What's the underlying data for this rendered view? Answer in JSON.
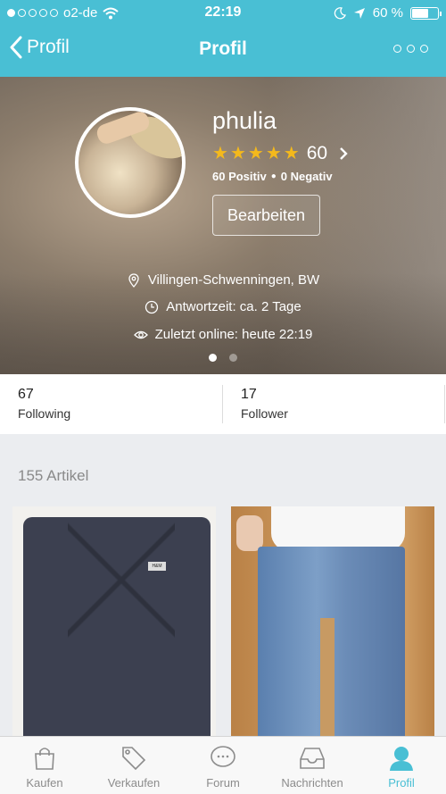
{
  "status_bar": {
    "carrier": "o2-de",
    "time": "22:19",
    "battery": "60 %",
    "battery_level": 0.6
  },
  "nav": {
    "back_label": "Profil",
    "title": "Profil"
  },
  "profile": {
    "username": "phulia",
    "rating_count": "60",
    "stars": 5,
    "positive": "60 Positiv",
    "negative": "0 Negativ",
    "edit_label": "Bearbeiten",
    "location": "Villingen-Schwenningen, BW",
    "response_time": "Antwortzeit: ca. 2 Tage",
    "last_online": "Zuletzt online: heute 22:19"
  },
  "follow": {
    "following_count": "67",
    "following_label": "Following",
    "follower_count": "17",
    "follower_label": "Follower"
  },
  "listings": {
    "title": "155 Artikel"
  },
  "tabs": [
    {
      "label": "Kaufen",
      "icon": "shopping-bag-icon"
    },
    {
      "label": "Verkaufen",
      "icon": "price-tag-icon"
    },
    {
      "label": "Forum",
      "icon": "chat-bubble-icon"
    },
    {
      "label": "Nachrichten",
      "icon": "inbox-icon"
    },
    {
      "label": "Profil",
      "icon": "person-icon"
    }
  ],
  "colors": {
    "brand": "#49bfd4",
    "star": "#f4b91c",
    "tab_inactive": "#8c8c8c"
  }
}
